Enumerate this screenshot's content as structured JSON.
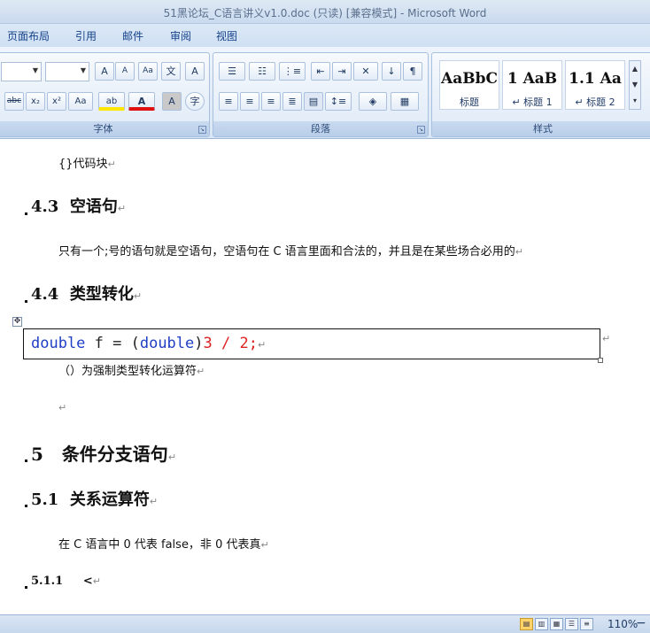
{
  "window": {
    "title": "51黑论坛_C语言讲义v1.0.doc (只读) [兼容模式] - Microsoft Word"
  },
  "tabs": [
    "页面布局",
    "引用",
    "邮件",
    "审阅",
    "视图"
  ],
  "ribbon": {
    "font_group_label": "字体",
    "paragraph_group_label": "段落",
    "styles_group_label": "样式",
    "font_buttons": {
      "grow": "A",
      "shrink": "A",
      "clear": "Aa",
      "phonetic": "文",
      "border": "A",
      "strike": "abc",
      "sub": "x₂",
      "sup": "x²",
      "case": "Aa",
      "highlight": "ab",
      "color": "A",
      "shade": "A",
      "enclose": "字"
    },
    "styles": [
      {
        "preview": "AaBbC",
        "name": "标题"
      },
      {
        "preview": "1  AaB",
        "name": "↵ 标题 1"
      },
      {
        "preview": "1.1  Aa",
        "name": "↵ 标题 2"
      }
    ]
  },
  "document": {
    "line_code_block": "{}代码块",
    "h_4_3_num": "4.3",
    "h_4_3_text": "空语句",
    "p_empty_stmt": "只有一个;号的语句就是空语句，空语句在 C 语言里面和合法的，并且是在某些场合必用的",
    "h_4_4_num": "4.4",
    "h_4_4_text": "类型转化",
    "code": {
      "kw1": "double",
      "mid1": " f = (",
      "kw2": "double",
      "mid2": ")",
      "num1": "3",
      "mid3": " / ",
      "num2": "2",
      "end": ";"
    },
    "p_cast": "（）为强制类型转化运算符",
    "h_5_num": "5",
    "h_5_text": "条件分支语句",
    "h_5_1_num": "5.1",
    "h_5_1_text": "关系运算符",
    "p_bool": "在 C 语言中 0 代表 false，非 0 代表真",
    "h_5_1_1_num": "5.1.1",
    "h_5_1_1_text": "<",
    "para_mark": "↵"
  },
  "status": {
    "zoom": "110%",
    "zoom_minus": "−"
  }
}
